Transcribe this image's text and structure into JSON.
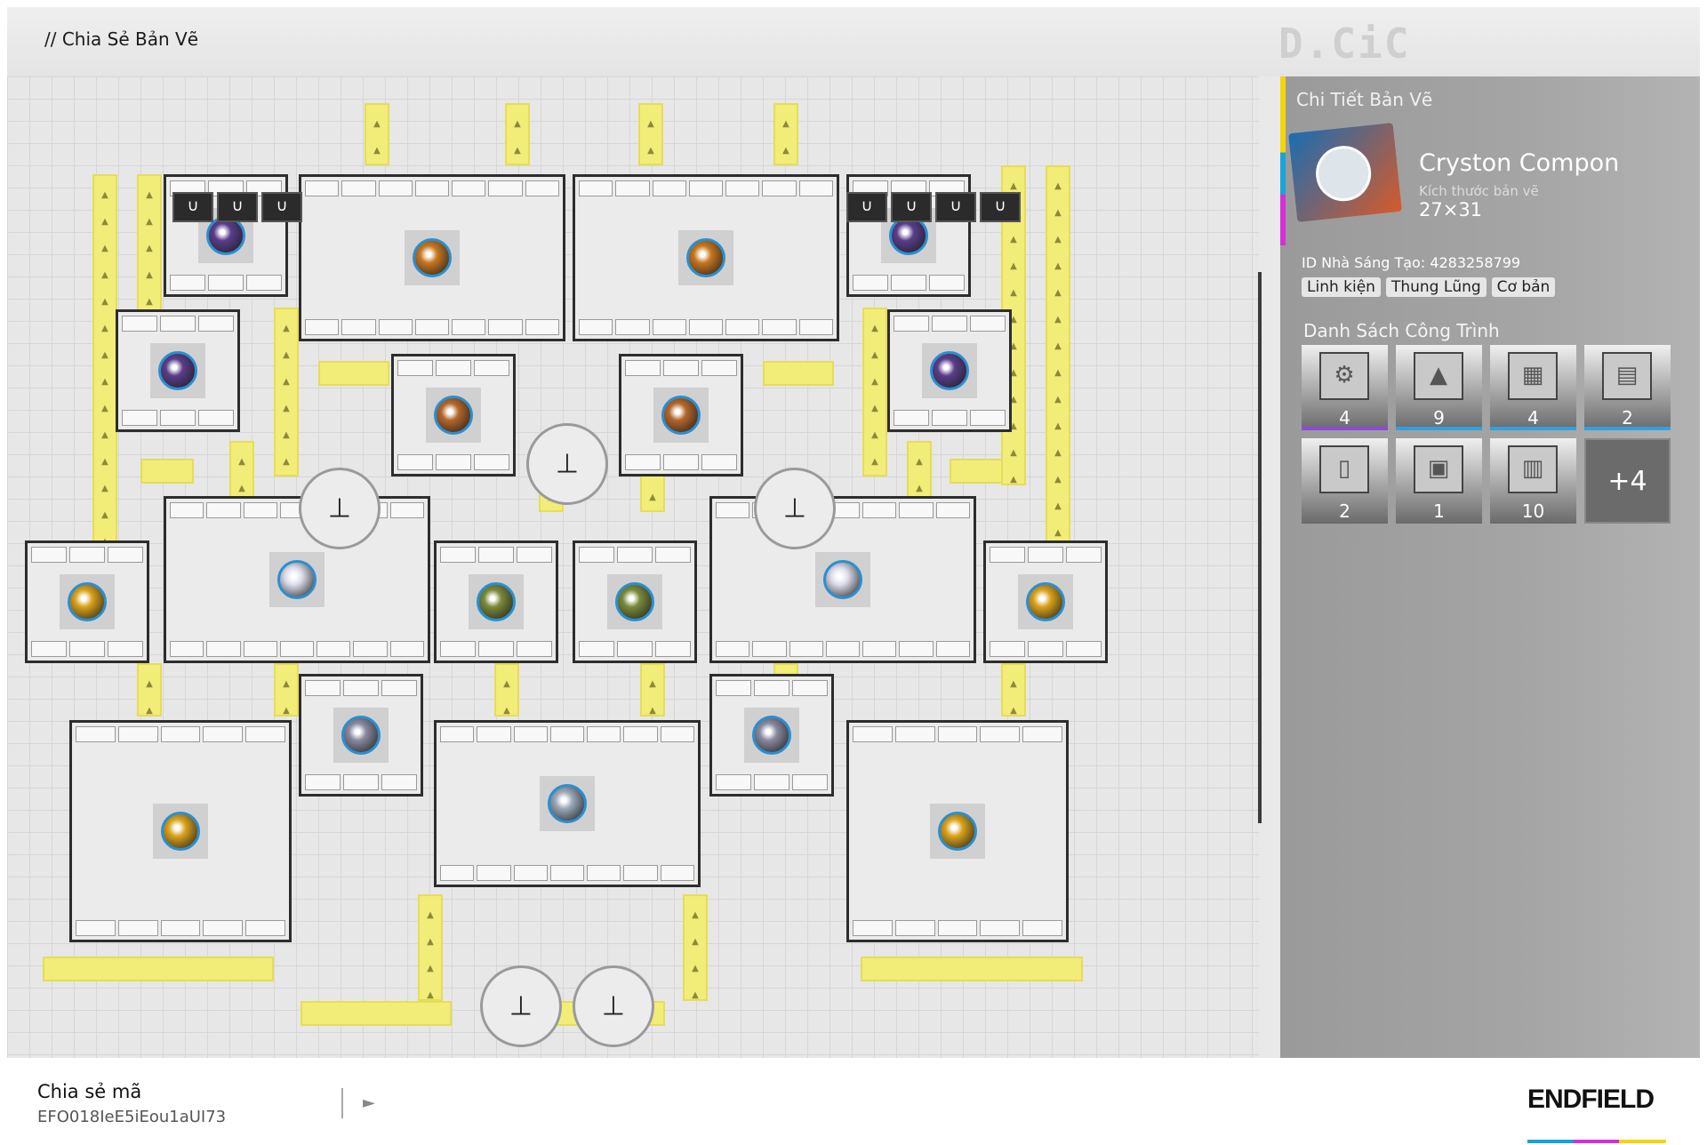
{
  "header": {
    "title": "// Chia Sẻ Bản Vẽ",
    "watermark": "D.CiC"
  },
  "details": {
    "panel_title": "Chi Tiết Bản Vẽ",
    "blueprint_name": "Cryston Compon",
    "size_label": "Kích thước bản vẽ",
    "size_value": "27×31",
    "creator": "ID Nhà Sáng Tạo: 4283258799",
    "tags": [
      "Linh kiện",
      "Thung Lũng",
      "Cơ bản"
    ],
    "list_title": "Danh Sách Công Trình",
    "buildings": [
      {
        "icon": "refinery-icon",
        "count": "4",
        "rarity_color": "#8a4bd6"
      },
      {
        "icon": "shredder-icon",
        "count": "9",
        "rarity_color": "#2fa0e0"
      },
      {
        "icon": "fitting-unit-icon",
        "count": "4",
        "rarity_color": "#2fa0e0"
      },
      {
        "icon": "packer-icon",
        "count": "2",
        "rarity_color": "#2fa0e0"
      },
      {
        "icon": "storage-icon",
        "count": "2",
        "rarity_color": ""
      },
      {
        "icon": "port-icon",
        "count": "1",
        "rarity_color": ""
      },
      {
        "icon": "depot-icon",
        "count": "10",
        "rarity_color": ""
      }
    ],
    "more_label": "+4"
  },
  "footer": {
    "share_label": "Chia sẻ mã",
    "share_code": "EFO018IeE5iEou1aUI73",
    "copy_icon": "play-arrow-icon",
    "brand": "ENDFIELD"
  },
  "canvas": {
    "tower_icon": "relay-tower-icon",
    "bin_icon": "storage-bin-icon",
    "machines": [
      {
        "name": "amethyst-refinery",
        "orb": "#5a3d8a"
      },
      {
        "name": "ore-crusher",
        "orb": "#c8771f"
      },
      {
        "name": "ore-crusher",
        "orb": "#c8771f"
      },
      {
        "name": "amethyst-refinery",
        "orb": "#5a3d8a"
      },
      {
        "name": "amethyst-refinery",
        "orb": "#5a3d8a"
      },
      {
        "name": "copper-refinery",
        "orb": "#b5662a"
      },
      {
        "name": "copper-refinery",
        "orb": "#b5662a"
      },
      {
        "name": "amethyst-refinery",
        "orb": "#5a3d8a"
      },
      {
        "name": "gold-smelter",
        "orb": "#d9a21a"
      },
      {
        "name": "crystal-shaper",
        "orb": "#dcdcea"
      },
      {
        "name": "component-filler",
        "orb": "#7a8a3a"
      },
      {
        "name": "component-filler",
        "orb": "#7a8a3a"
      },
      {
        "name": "crystal-shaper",
        "orb": "#dcdcea"
      },
      {
        "name": "gold-smelter",
        "orb": "#d9a21a"
      },
      {
        "name": "fiber-grinder",
        "orb": "#8a8aa0"
      },
      {
        "name": "fiber-grinder",
        "orb": "#8a8aa0"
      },
      {
        "name": "gold-assembler",
        "orb": "#d9a21a"
      },
      {
        "name": "cryston-packer",
        "orb": "#9aa8b8"
      },
      {
        "name": "gold-assembler",
        "orb": "#d9a21a"
      }
    ]
  }
}
